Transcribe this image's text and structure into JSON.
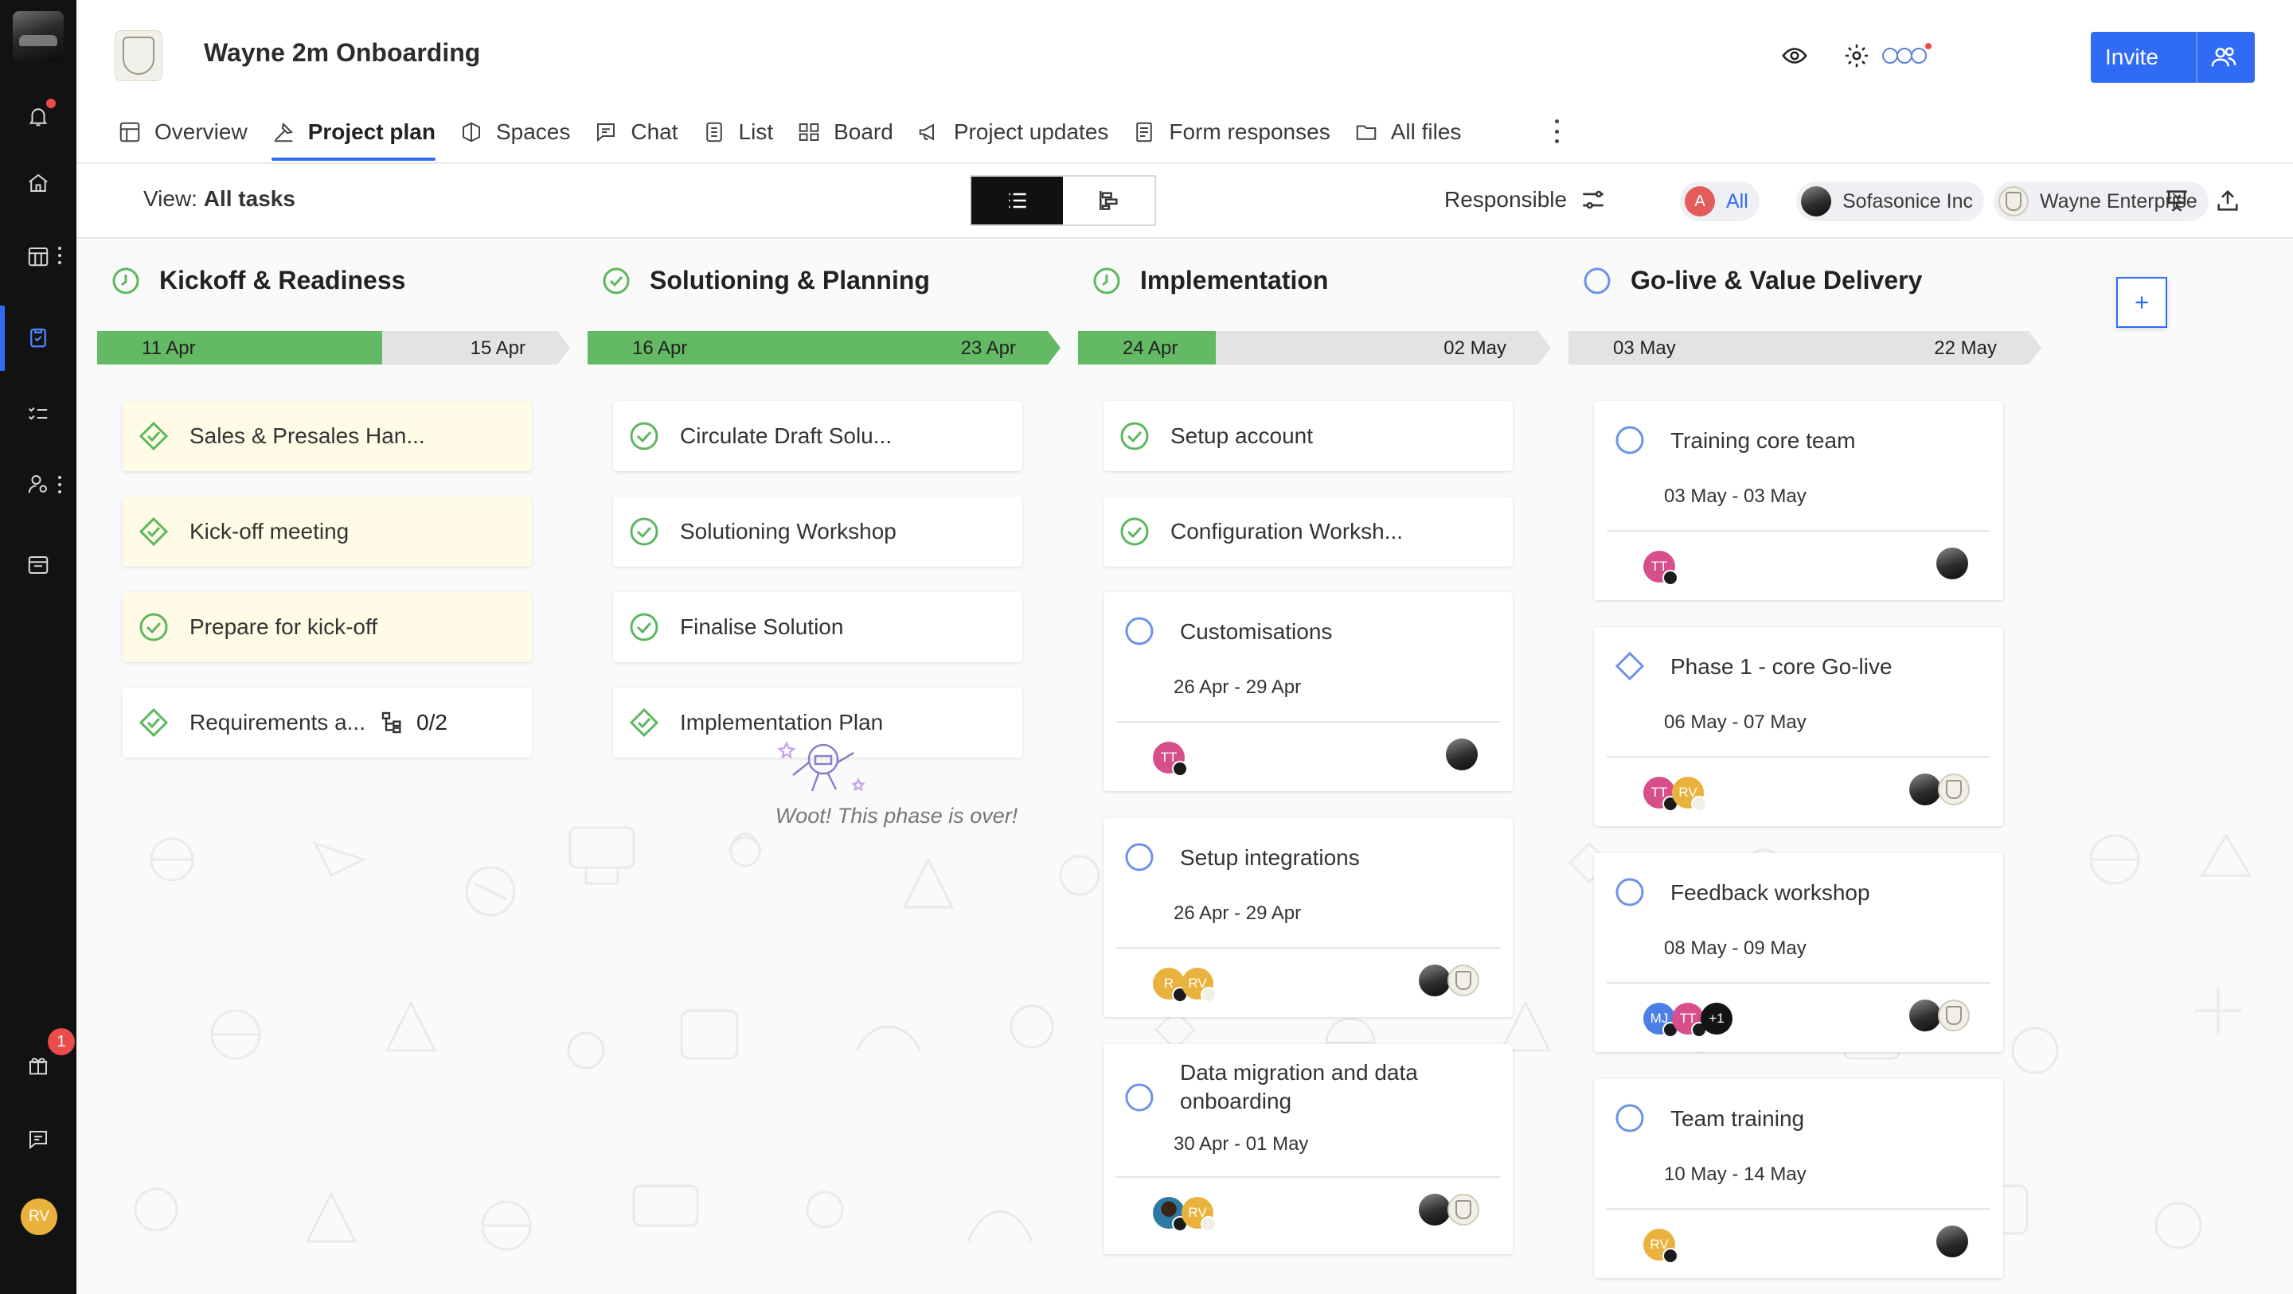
{
  "app": {
    "project_title": "Wayne 2m Onboarding",
    "invite_label": "Invite",
    "accent": "#2f6bf5",
    "rail_badge": "1",
    "rail_user_initials": "RV"
  },
  "tabs": [
    {
      "label": "Overview",
      "icon": "overview-icon"
    },
    {
      "label": "Project plan",
      "icon": "plan-icon",
      "active": true
    },
    {
      "label": "Spaces",
      "icon": "spaces-icon"
    },
    {
      "label": "Chat",
      "icon": "chat-icon"
    },
    {
      "label": "List",
      "icon": "list-icon"
    },
    {
      "label": "Board",
      "icon": "board-icon"
    },
    {
      "label": "Project updates",
      "icon": "megaphone-icon"
    },
    {
      "label": "Form responses",
      "icon": "form-icon"
    },
    {
      "label": "All files",
      "icon": "folder-icon"
    }
  ],
  "toolbar": {
    "view_prefix": "View:",
    "view_value": "All tasks",
    "responsible_label": "Responsible",
    "filters": [
      {
        "label": "All",
        "initial": "A",
        "color": "#e45b5b",
        "active": true
      },
      {
        "label": "Sofasonice Inc"
      },
      {
        "label": "Wayne Enterprise"
      }
    ]
  },
  "phases": [
    {
      "title": "Kickoff & Readiness",
      "start": "11 Apr",
      "end": "15 Apr",
      "progress": 0.62,
      "tasks": [
        {
          "title": "Sales & Presales Han...",
          "status": "milestone-done",
          "highlight": true
        },
        {
          "title": "Kick-off meeting",
          "status": "milestone-done",
          "highlight": true
        },
        {
          "title": "Prepare for kick-off",
          "status": "done",
          "highlight": true
        },
        {
          "title": "Requirements a...",
          "status": "milestone-done",
          "subtasks": "0/2"
        }
      ]
    },
    {
      "title": "Solutioning & Planning",
      "start": "16 Apr",
      "end": "23 Apr",
      "progress": 1.0,
      "tasks": [
        {
          "title": "Circulate Draft Solu...",
          "status": "done"
        },
        {
          "title": "Solutioning Workshop",
          "status": "done"
        },
        {
          "title": "Finalise Solution",
          "status": "done"
        },
        {
          "title": "Implementation Plan",
          "status": "milestone-done"
        }
      ],
      "empty_message": "Woot! This phase is over!"
    },
    {
      "title": "Implementation",
      "start": "24 Apr",
      "end": "02 May",
      "progress": 0.3,
      "tasks": [
        {
          "title": "Setup account",
          "status": "done"
        },
        {
          "title": "Configuration Worksh...",
          "status": "done"
        }
      ],
      "cards": [
        {
          "title": "Customisations",
          "dates": "26 Apr - 29 Apr"
        },
        {
          "title": "Setup integrations",
          "dates": "26 Apr - 29 Apr"
        },
        {
          "title": "Data migration and data onboarding",
          "dates": "30 Apr - 01 May"
        }
      ]
    },
    {
      "title": "Go-live & Value Delivery",
      "start": "03 May",
      "end": "22 May",
      "progress": 0.0,
      "cards": [
        {
          "title": "Training core team",
          "dates": "03 May - 03 May"
        },
        {
          "title": "Phase 1 - core Go-live",
          "dates": "06 May - 07 May",
          "milestone": true
        },
        {
          "title": "Feedback workshop",
          "dates": "08 May - 09 May",
          "extra": "+1"
        },
        {
          "title": "Team training",
          "dates": "10 May - 14 May"
        }
      ]
    }
  ],
  "avatars": {
    "tt": "TT",
    "rv": "RV",
    "r": "R",
    "mj": "MJ"
  }
}
